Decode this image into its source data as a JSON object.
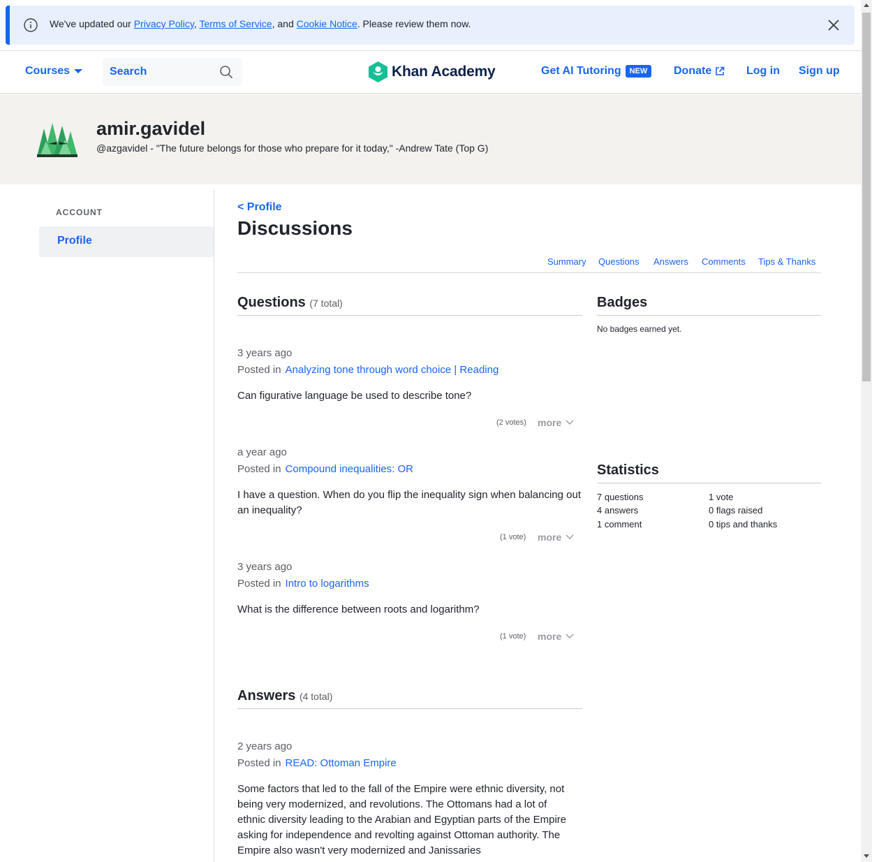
{
  "banner": {
    "prefix": "We've updated our ",
    "privacy": "Privacy Policy",
    "sep1": ", ",
    "terms": "Terms of Service",
    "sep2": ", and ",
    "cookie": "Cookie Notice",
    "suffix": ". Please review them now."
  },
  "header": {
    "courses": "Courses",
    "search_label": "Search",
    "logo": "Khan Academy",
    "tutoring": "Get AI Tutoring",
    "new_badge": "NEW",
    "donate": "Donate",
    "login": "Log in",
    "signup": "Sign up"
  },
  "profile": {
    "name": "amir.gavidel",
    "bio": "@azgavidel - \"The future belongs for those who prepare for it today,\" -Andrew Tate (Top G)"
  },
  "sidebar": {
    "account_label": "ACCOUNT",
    "profile": "Profile"
  },
  "main": {
    "back": "< Profile",
    "title": "Discussions",
    "tabs": [
      "Summary",
      "Questions",
      "Answers",
      "Comments",
      "Tips & Thanks"
    ]
  },
  "questions": {
    "title": "Questions",
    "count": "(7 total)",
    "posted_prefix": "Posted in",
    "more": "more",
    "items": [
      {
        "time": "3 years ago",
        "link": "Analyzing tone through word choice | Reading",
        "body": "Can figurative language be used to describe tone?",
        "votes": "(2 votes)"
      },
      {
        "time": "a year ago",
        "link": "Compound inequalities: OR",
        "body": "I have a question. When do you flip the inequality sign when balancing out an inequality?",
        "votes": "(1 vote)"
      },
      {
        "time": "3 years ago",
        "link": "Intro to logarithms",
        "body": "What is the difference between roots and logarithm?",
        "votes": "(1 vote)"
      }
    ]
  },
  "answers": {
    "title": "Answers",
    "count": "(4 total)",
    "items": [
      {
        "time": "2 years ago",
        "link": "READ: Ottoman Empire",
        "body": "Some factors that led to the fall of the Empire were ethnic diversity, not being very modernized, and revolutions. The Ottomans had a lot of ethnic diversity leading to the Arabian and Egyptian parts of the Empire asking for independence and revolting against Ottoman authority. The Empire also wasn't very modernized and Janissaries"
      }
    ]
  },
  "badges": {
    "title": "Badges",
    "empty": "No badges earned yet."
  },
  "statistics": {
    "title": "Statistics",
    "left": [
      "7 questions",
      "4 answers",
      "1 comment"
    ],
    "right": [
      "1 vote",
      "0 flags raised",
      "0 tips and thanks"
    ]
  },
  "colors": {
    "accent": "#1865f2",
    "band": "#f3f2ef",
    "banner": "#e8f0fe"
  }
}
